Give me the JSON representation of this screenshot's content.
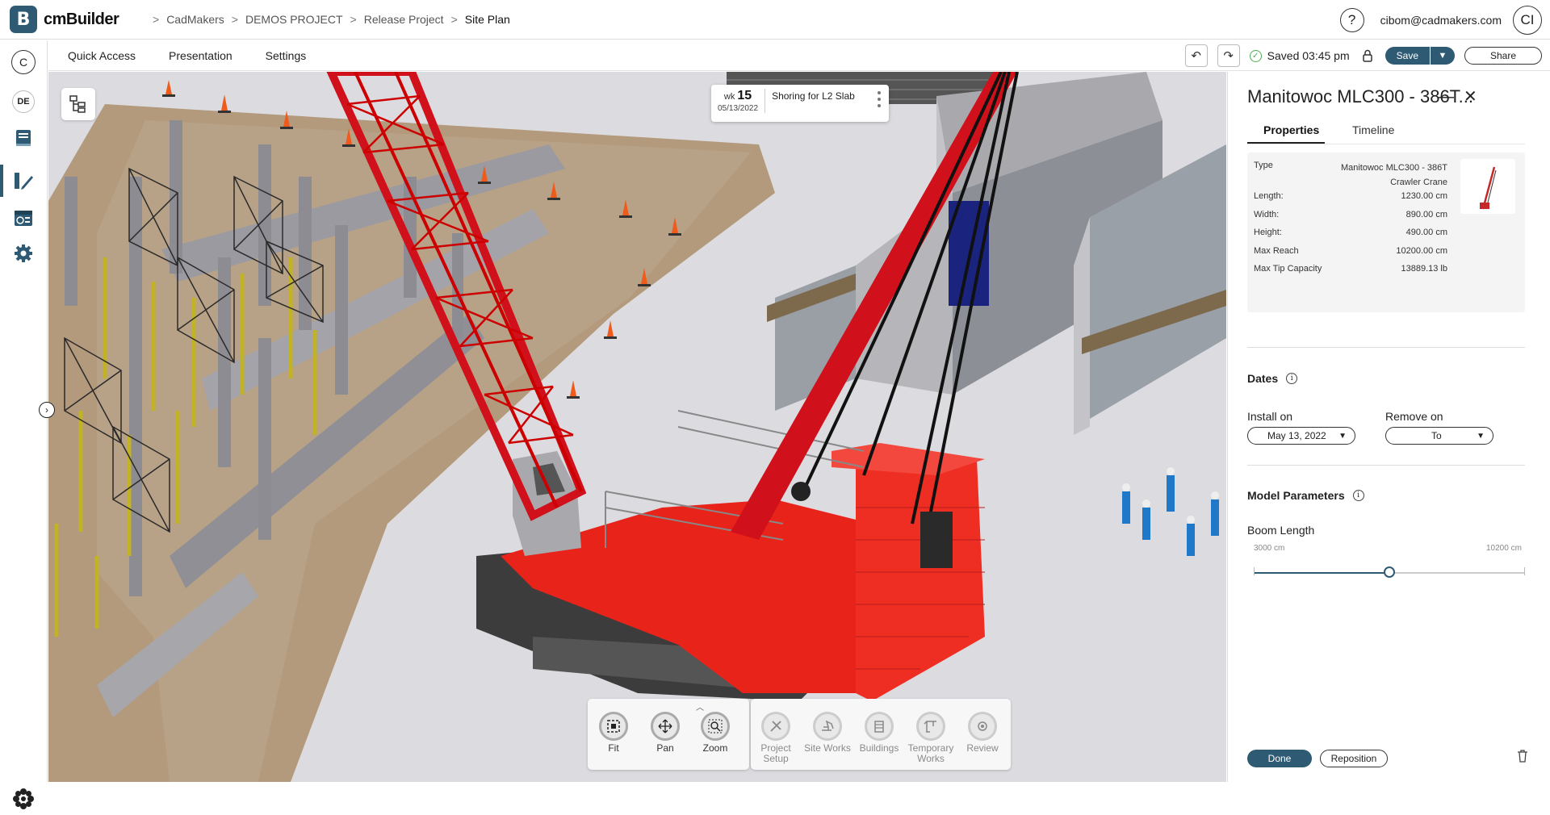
{
  "app": {
    "name": "cmBuilder",
    "logo_letter": "B"
  },
  "breadcrumbs": [
    "CadMakers",
    "DEMOS PROJECT",
    "Release Project",
    "Site Plan"
  ],
  "user": {
    "help": "?",
    "email": "cibom@cadmakers.com",
    "initials": "CI"
  },
  "sidebar": {
    "top_letter": "C",
    "region": "DE"
  },
  "menu": [
    "Quick Access",
    "Presentation",
    "Settings"
  ],
  "status": {
    "saved": "Saved 03:45 pm"
  },
  "buttons": {
    "save": "Save",
    "share": "Share",
    "done": "Done",
    "reposition": "Reposition"
  },
  "schedule": {
    "wk_label": "wk",
    "week": "15",
    "date": "05/13/2022",
    "task": "Shoring for L2 Slab"
  },
  "nav_tools": [
    {
      "label": "Fit",
      "icon": "fit-icon"
    },
    {
      "label": "Pan",
      "icon": "pan-icon"
    },
    {
      "label": "Zoom",
      "icon": "zoom-icon"
    }
  ],
  "build_tools": [
    {
      "label": "Project Setup",
      "icon": "wrench-icon"
    },
    {
      "label": "Site Works",
      "icon": "excavator-icon"
    },
    {
      "label": "Buildings",
      "icon": "building-icon"
    },
    {
      "label": "Temporary Works",
      "icon": "crane-icon"
    },
    {
      "label": "Review",
      "icon": "review-icon"
    }
  ],
  "panel": {
    "title": "Manitowoc MLC300 - 386T...",
    "tabs": [
      "Properties",
      "Timeline"
    ],
    "properties": [
      {
        "label": "Type",
        "value": "Manitowoc MLC300 - 386T Crawler Crane"
      },
      {
        "label": "Length:",
        "value": "1230.00 cm"
      },
      {
        "label": "Width:",
        "value": "890.00 cm"
      },
      {
        "label": "Height:",
        "value": "490.00 cm"
      },
      {
        "label": "Max Reach",
        "value": "10200.00 cm"
      },
      {
        "label": "Max Tip Capacity",
        "value": "13889.13 lb"
      }
    ],
    "dates_title": "Dates",
    "install_label": "Install on",
    "install_value": "May 13, 2022",
    "remove_label": "Remove on",
    "remove_value": "To",
    "model_title": "Model Parameters",
    "boom_label": "Boom Length",
    "boom_min": "3000 cm",
    "boom_max": "10200 cm",
    "boom_fraction": 0.5
  },
  "colors": {
    "brand": "#2f5a73",
    "crane_red": "#e8231a",
    "saved_green": "#4caf50"
  }
}
